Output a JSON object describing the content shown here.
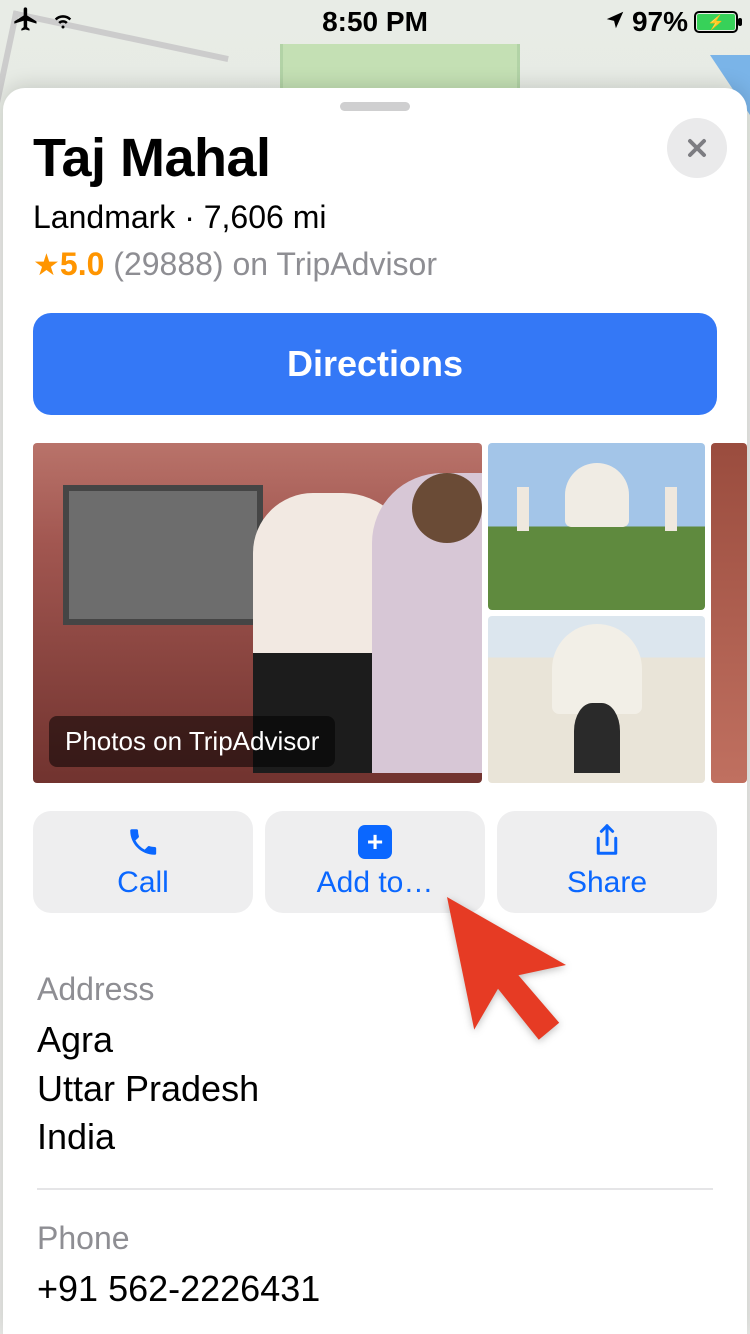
{
  "status": {
    "time": "8:50 PM",
    "battery_text": "97%"
  },
  "place": {
    "title": "Taj Mahal",
    "category": "Landmark",
    "distance": "7,606 mi",
    "rating": "5.0",
    "review_count": "(29888)",
    "review_source": "on TripAdvisor",
    "photo_caption": "Photos on TripAdvisor"
  },
  "buttons": {
    "directions": "Directions",
    "call": "Call",
    "add_to": "Add to…",
    "share": "Share"
  },
  "details": {
    "address_label": "Address",
    "address_line1": "Agra",
    "address_line2": "Uttar Pradesh",
    "address_line3": "India",
    "phone_label": "Phone",
    "phone_value": "+91 562-2226431"
  }
}
